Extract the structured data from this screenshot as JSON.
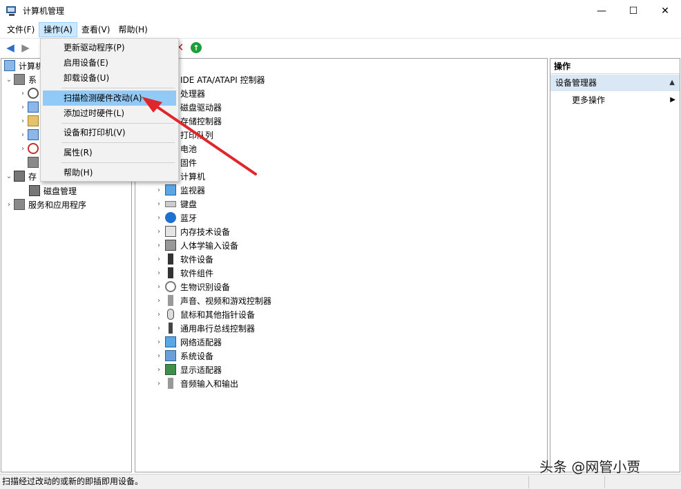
{
  "window": {
    "title": "计算机管理",
    "minimize": "—",
    "maximize": "☐",
    "close": "✕"
  },
  "menubar": {
    "items": [
      "文件(F)",
      "操作(A)",
      "查看(V)",
      "帮助(H)"
    ],
    "active": "操作(A)"
  },
  "dropdown": {
    "items": [
      "更新驱动程序(P)",
      "启用设备(E)",
      "卸载设备(U)",
      "扫描检测硬件改动(A)",
      "添加过时硬件(L)",
      "设备和打印机(V)",
      "属性(R)",
      "帮助(H)"
    ],
    "highlighted": "扫描检测硬件改动(A)"
  },
  "tree": {
    "root": "计算机",
    "system": "系",
    "storage": "存",
    "disk_mgmt": "磁盘管理",
    "services": "服务和应用程序"
  },
  "devices": [
    "IDE ATA/ATAPI 控制器",
    "处理器",
    "磁盘驱动器",
    "存储控制器",
    "打印队列",
    "电池",
    "固件",
    "计算机",
    "监视器",
    "键盘",
    "蓝牙",
    "内存技术设备",
    "人体学输入设备",
    "软件设备",
    "软件组件",
    "生物识别设备",
    "声音、视频和游戏控制器",
    "鼠标和其他指针设备",
    "通用串行总线控制器",
    "网络适配器",
    "系统设备",
    "显示适配器",
    "音频输入和输出"
  ],
  "actions": {
    "header": "操作",
    "section": "设备管理器",
    "more": "更多操作"
  },
  "status": {
    "text": "扫描经过改动的或新的即插即用设备。"
  },
  "watermark": "头条 @网管小贾",
  "colors": {
    "highlight": "#91c9f7",
    "menu_active": "#cce8ff",
    "section_bg": "#dae7f5",
    "arrow": "#e0262a"
  }
}
